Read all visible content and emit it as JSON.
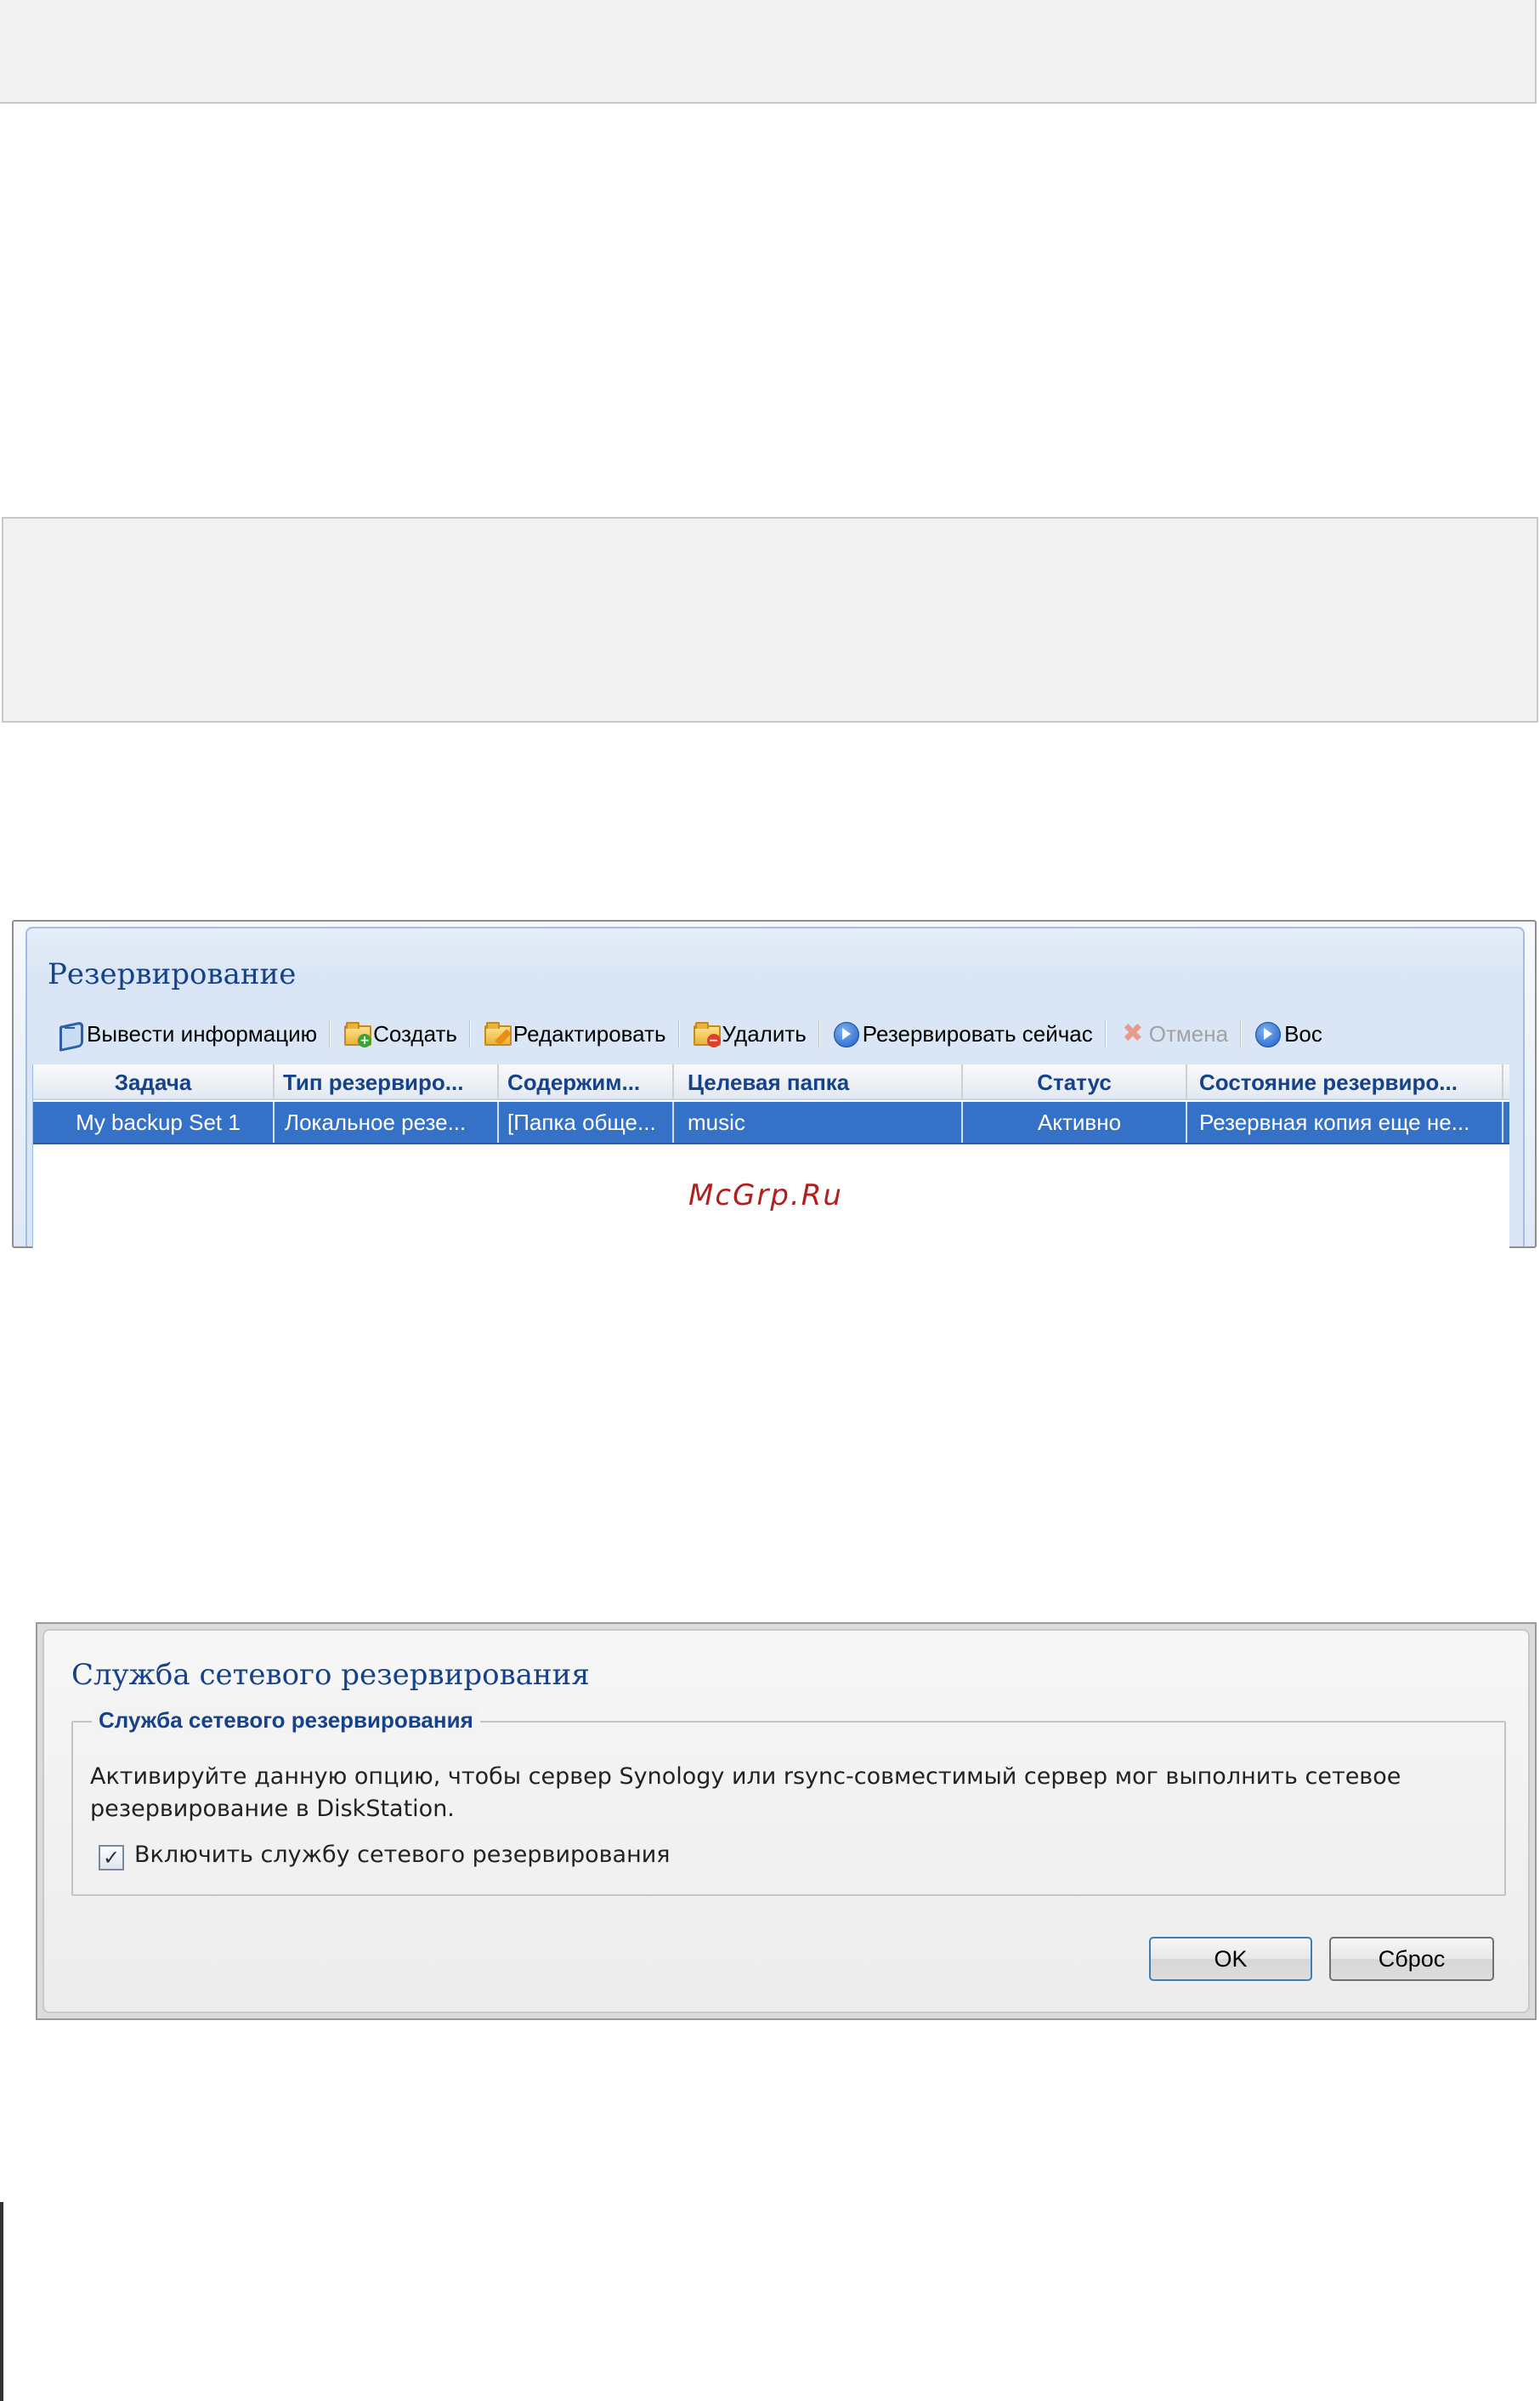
{
  "backup_window": {
    "title": "Резервирование",
    "toolbar": {
      "info": "Вывести информацию",
      "create": "Создать",
      "edit": "Редактировать",
      "delete": "Удалить",
      "backup_now": "Резервировать сейчас",
      "cancel": "Отмена",
      "restore": "Вос"
    },
    "columns": [
      "Задача",
      "Тип резервиро...",
      "Содержим...",
      "Целевая папка",
      "Статус",
      "Состояние резервиро..."
    ],
    "rows": [
      [
        "My backup Set 1",
        "Локальное резе...",
        "[Папка обще...",
        "music",
        "Активно",
        "Резервная копия еще не..."
      ]
    ],
    "watermark": "McGrp.Ru"
  },
  "network_window": {
    "title": "Служба сетевого резервирования",
    "group_title": "Служба сетевого резервирования",
    "description_line1": "Активируйте данную опцию, чтобы сервер Synology или rsync-совместимый сервер мог выполнить сетевое",
    "description_line2": "резервирование в DiskStation.",
    "checkbox_label": "Включить службу сетевого резервирования",
    "checkbox_checked": true,
    "checkbox_glyph": "✓",
    "ok_label": "OK",
    "reset_label": "Сброс"
  },
  "colors": {
    "title_blue": "#15428b",
    "selection_blue": "#3471c7",
    "watermark_red": "#b02020"
  },
  "icons": [
    "info-book-icon",
    "create-folder-icon",
    "edit-folder-icon",
    "delete-folder-icon",
    "backup-now-play-icon",
    "cancel-x-icon",
    "restore-play-icon"
  ]
}
